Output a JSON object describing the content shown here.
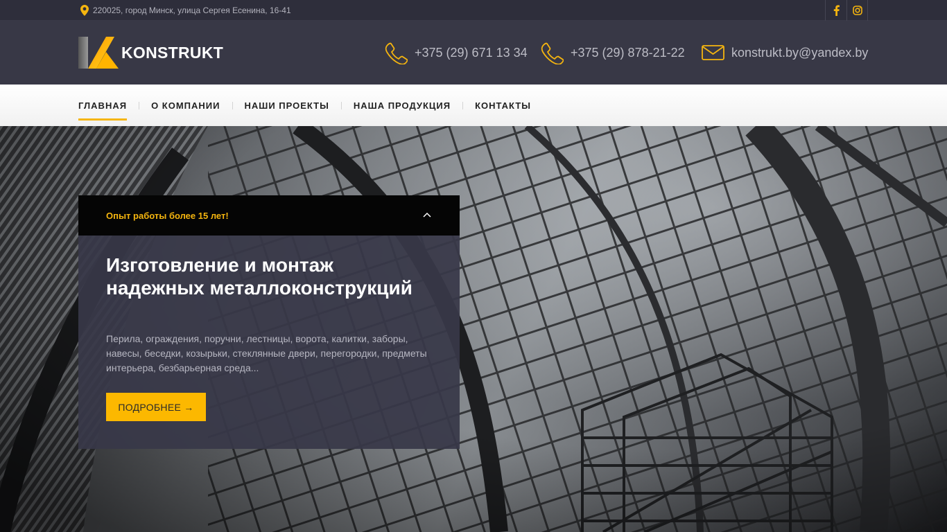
{
  "topbar": {
    "address": "220025, город Минск, улица Сергея Есенина, 16-41",
    "social": [
      {
        "icon": "facebook-icon"
      },
      {
        "icon": "instagram-icon"
      }
    ]
  },
  "header": {
    "logo_text": "KONSTRUKT",
    "phone1": "+375 (29) 671 13 34",
    "phone2": "+375 (29) 878-21-22",
    "email": "konstrukt.by@yandex.by"
  },
  "nav": {
    "items": [
      {
        "label": "ГЛАВНАЯ",
        "active": true
      },
      {
        "label": "О КОМПАНИИ"
      },
      {
        "label": "НАШИ ПРОЕКТЫ"
      },
      {
        "label": "НАША ПРОДУКЦИЯ"
      },
      {
        "label": "КОНТАКТЫ"
      }
    ]
  },
  "hero": {
    "tagline": "Опыт работы более 15 лет!",
    "title": "Изготовление и монтаж надежных металлоконструкций",
    "description": "Перила, ограждения, поручни, лестницы, ворота, калитки, заборы, навесы, беседки, козырьки, стеклянные двери, перегородки, предметы интерьера, безбарьерная среда...",
    "button": "ПОДРОБНЕЕ →"
  },
  "colors": {
    "accent": "#fcb800",
    "header_bg": "#383846",
    "topbar_bg": "#2e2e3b",
    "slide_tab_bg": "#050505"
  }
}
